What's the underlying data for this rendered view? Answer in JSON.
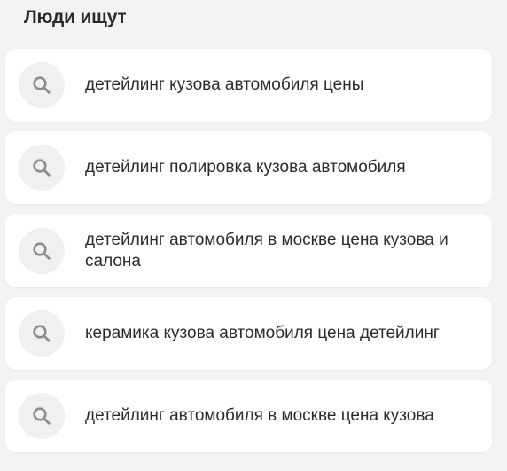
{
  "section": {
    "title": "Люди ищут"
  },
  "items": [
    {
      "label": "детейлинг кузова автомобиля цены",
      "icon": "search-icon"
    },
    {
      "label": "детейлинг полировка кузова автомобиля",
      "icon": "search-icon"
    },
    {
      "label": "детейлинг автомобиля в москве цена кузова и салона",
      "icon": "search-icon"
    },
    {
      "label": "керамика кузова автомобиля цена детейлинг",
      "icon": "search-icon"
    },
    {
      "label": "детейлинг автомобиля в москве цена кузова",
      "icon": "search-icon"
    }
  ],
  "colors": {
    "background": "#f3f3f6",
    "card": "#ffffff",
    "icon_circle": "#f0f0f0",
    "icon": "#8c8c8c",
    "text": "#2b2b2b"
  }
}
